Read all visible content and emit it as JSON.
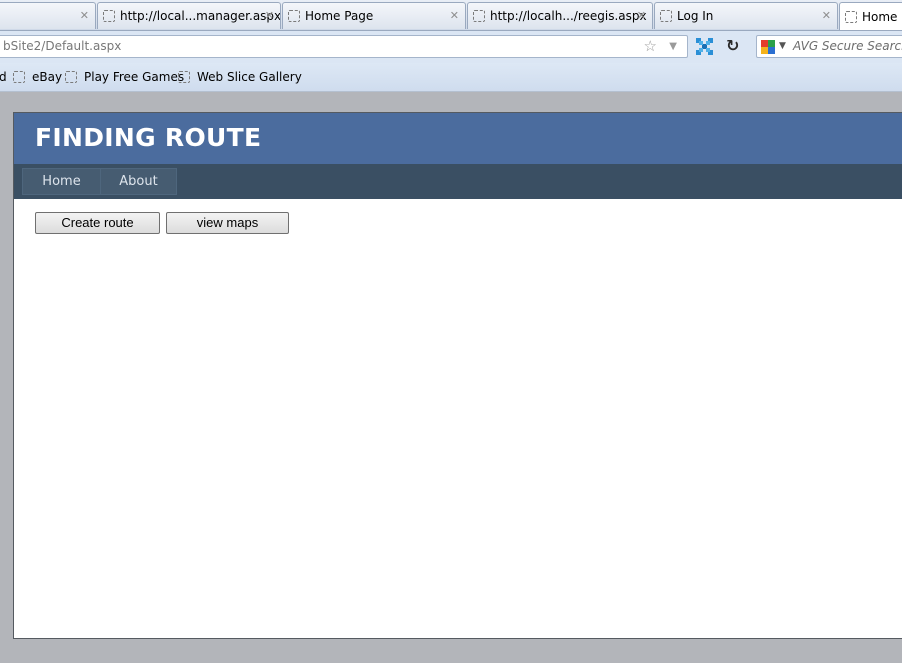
{
  "browser": {
    "tabs": [
      {
        "label": ""
      },
      {
        "label": "http://local...manager.aspx"
      },
      {
        "label": "Home Page"
      },
      {
        "label": "http://localh.../reegis.aspx"
      },
      {
        "label": "Log In"
      },
      {
        "label": "Home P"
      }
    ],
    "address": "bSite2/Default.aspx",
    "search_placeholder": "AVG Secure Search",
    "bookmarks": [
      {
        "label": "d"
      },
      {
        "label": "eBay"
      },
      {
        "label": "Play Free Games"
      },
      {
        "label": "Web Slice Gallery"
      }
    ]
  },
  "site": {
    "title": "FINDING ROUTE",
    "menu": [
      {
        "label": "Home"
      },
      {
        "label": "About"
      }
    ],
    "buttons": {
      "create_route": "Create route",
      "view_maps": "view maps"
    }
  },
  "colors": {
    "header": "#4b6c9e",
    "menu_bar": "#3a4f63",
    "menu_item": "#465c71"
  }
}
